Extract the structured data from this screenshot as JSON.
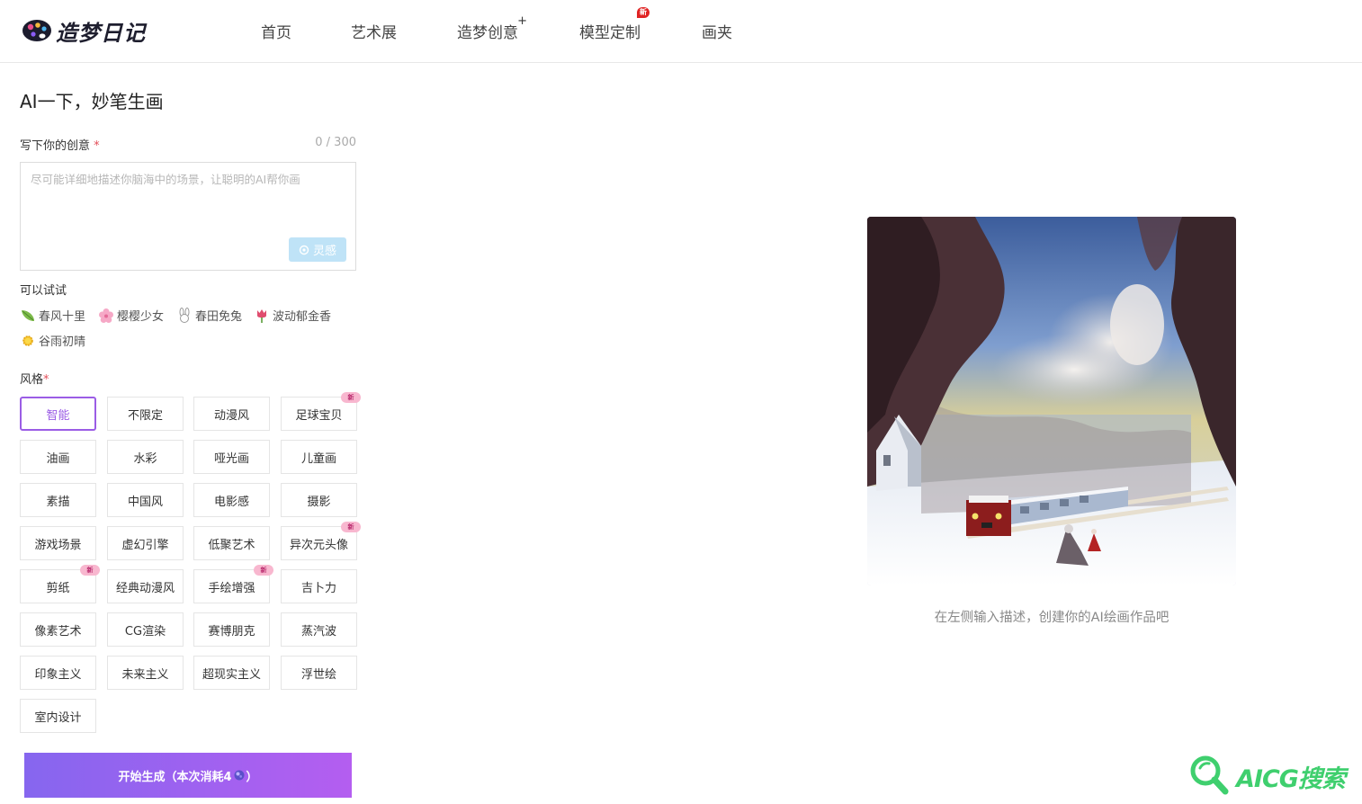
{
  "header": {
    "logo_text": "造梦日记",
    "nav": [
      {
        "label": "首页"
      },
      {
        "label": "艺术展"
      },
      {
        "label": "造梦创意",
        "marker": "+"
      },
      {
        "label": "模型定制",
        "badge": "新"
      },
      {
        "label": "画夹"
      }
    ]
  },
  "panel": {
    "title": "AI一下，妙笔生画",
    "prompt_label": "写下你的创意",
    "required_mark": "*",
    "counter": "0 / 300",
    "prompt_value": "",
    "prompt_placeholder": "尽可能详细地描述你脑海中的场景，让聪明的AI帮你画",
    "inspire_label": "灵感",
    "try_label": "可以试试",
    "suggestions": [
      {
        "label": "春风十里",
        "icon": "leaf-icon"
      },
      {
        "label": "樱樱少女",
        "icon": "sakura-icon"
      },
      {
        "label": "春田免兔",
        "icon": "rabbit-icon"
      },
      {
        "label": "波动郁金香",
        "icon": "tulip-icon"
      },
      {
        "label": "谷雨初晴",
        "icon": "sun-icon"
      }
    ],
    "style_label": "风格",
    "styles": [
      {
        "label": "智能",
        "selected": true
      },
      {
        "label": "不限定"
      },
      {
        "label": "动漫风"
      },
      {
        "label": "足球宝贝",
        "new": true
      },
      {
        "label": "油画"
      },
      {
        "label": "水彩"
      },
      {
        "label": "哑光画"
      },
      {
        "label": "儿童画"
      },
      {
        "label": "素描"
      },
      {
        "label": "中国风"
      },
      {
        "label": "电影感"
      },
      {
        "label": "摄影"
      },
      {
        "label": "游戏场景"
      },
      {
        "label": "虚幻引擎"
      },
      {
        "label": "低聚艺术"
      },
      {
        "label": "异次元头像",
        "new": true
      },
      {
        "label": "剪纸",
        "new": true
      },
      {
        "label": "经典动漫风"
      },
      {
        "label": "手绘增强",
        "new": true
      },
      {
        "label": "吉卜力"
      },
      {
        "label": "像素艺术"
      },
      {
        "label": "CG渲染"
      },
      {
        "label": "赛博朋克"
      },
      {
        "label": "蒸汽波"
      },
      {
        "label": "印象主义"
      },
      {
        "label": "未来主义"
      },
      {
        "label": "超现实主义"
      },
      {
        "label": "浮世绘"
      },
      {
        "label": "室内设计"
      }
    ],
    "new_tag": "新",
    "generate_label": "开始生成（本次消耗4",
    "generate_suffix": "）"
  },
  "preview": {
    "caption": "在左侧输入描述，创建你的AI绘画作品吧"
  },
  "watermark": {
    "text": "AICG搜索"
  },
  "colors": {
    "accent": "#9b5de5",
    "generate_from": "#8666ef",
    "generate_to": "#b45ef0",
    "new_badge": "#e02424",
    "watermark": "#3fcf6e"
  }
}
